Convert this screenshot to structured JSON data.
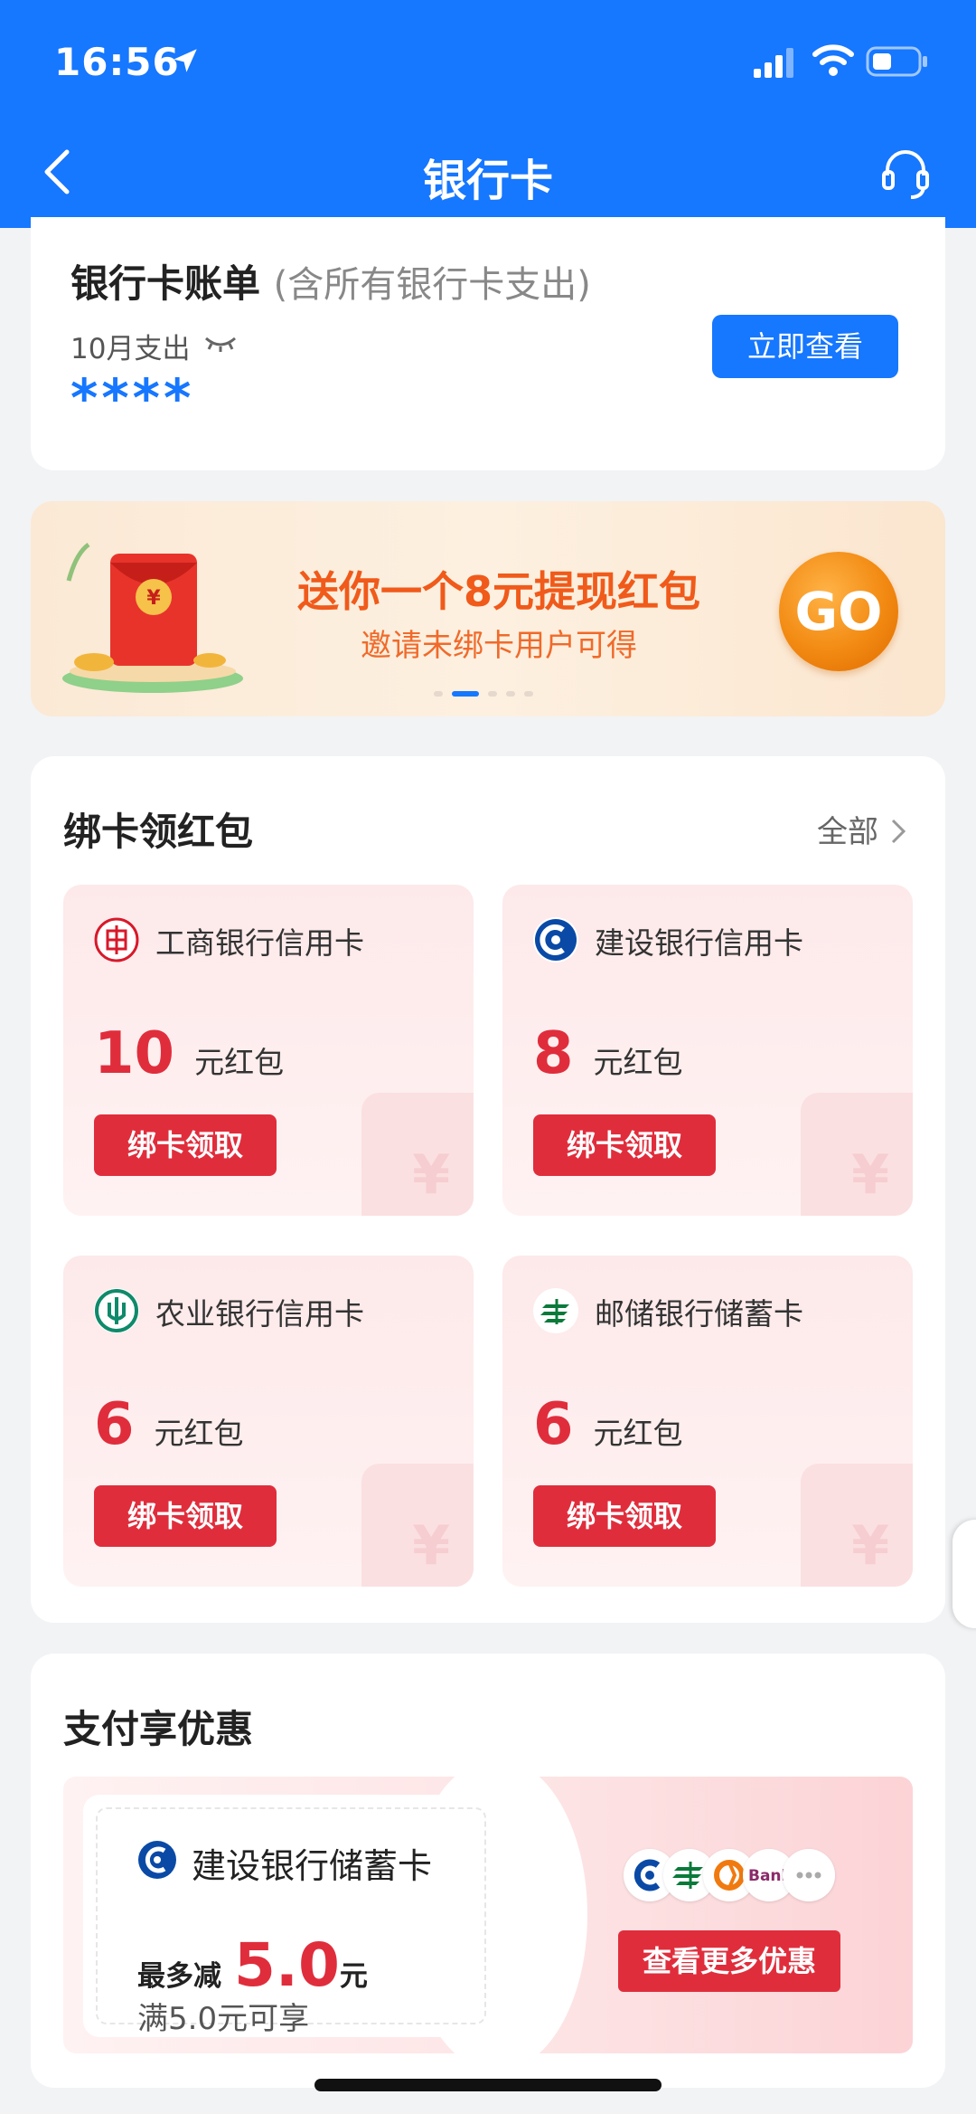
{
  "status_bar": {
    "time": "16:56"
  },
  "nav": {
    "title": "银行卡"
  },
  "bill": {
    "title": "银行卡账单",
    "subtitle": "(含所有银行卡支出)",
    "month_label": "10月支出",
    "masked_amount": "****",
    "view_button": "立即查看"
  },
  "banner": {
    "title": "送你一个8元提现红包",
    "subtitle": "邀请未绑卡用户可得",
    "go_label": "GO",
    "slide_count": 5,
    "active_slide": 1
  },
  "bind_section": {
    "title": "绑卡领红包",
    "all_label": "全部",
    "tiles": [
      {
        "bank": "工商银行信用卡",
        "amount": "10",
        "unit": "元红包",
        "button": "绑卡领取",
        "icon": "icbc-logo-icon",
        "color": "#d8192a"
      },
      {
        "bank": "建设银行信用卡",
        "amount": "8",
        "unit": "元红包",
        "button": "绑卡领取",
        "icon": "ccb-logo-icon",
        "color": "#0a4aa6"
      },
      {
        "bank": "农业银行信用卡",
        "amount": "6",
        "unit": "元红包",
        "button": "绑卡领取",
        "icon": "abc-logo-icon",
        "color": "#0f8a6a"
      },
      {
        "bank": "邮储银行储蓄卡",
        "amount": "6",
        "unit": "元红包",
        "button": "绑卡领取",
        "icon": "psbc-logo-icon",
        "color": "#0a7a3a"
      }
    ],
    "deco_symbol": "¥"
  },
  "pay_section": {
    "title": "支付享优惠",
    "coupon": {
      "bank": "建设银行储蓄卡",
      "max_label": "最多减",
      "amount": "5.0",
      "yuan": "元",
      "condition": "满5.0元可享"
    },
    "more_button": "查看更多优惠",
    "bank_logos": [
      "ccb-logo-icon",
      "psbc-logo-icon",
      "bank-logo-orange-icon",
      "bank-logo-text-icon",
      "more-dots-icon"
    ],
    "bank_logo_text": "Bank"
  },
  "colors": {
    "primary": "#1677ff",
    "red": "#e02d3c",
    "orange": "#f05a1a"
  }
}
